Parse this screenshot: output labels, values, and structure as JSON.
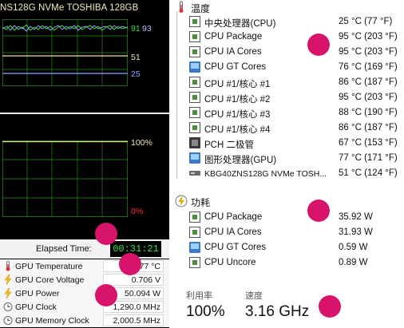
{
  "left_panel": {
    "drive_title": "NS128G NVMe TOSHIBA 128GB",
    "graph1": {
      "labels": [
        {
          "text": "91",
          "color": "#3ee14a"
        },
        {
          "text": "93",
          "color": "#b8b8ff"
        },
        {
          "text": "51",
          "color": "#f0ecb8"
        },
        {
          "text": "25",
          "color": "#8ea4ff"
        }
      ]
    },
    "graph2": {
      "top_label": "100%",
      "bottom_label": "0%"
    },
    "elapsed": {
      "label": "Elapsed Time:",
      "value": "00:31:21"
    },
    "sensors": [
      {
        "name": "GPU Temperature",
        "value": "77 °C",
        "icon": "thermometer-icon"
      },
      {
        "name": "GPU Core Voltage",
        "value": "0.706 V",
        "icon": "bolt-icon"
      },
      {
        "name": "GPU Power",
        "value": "50.094 W",
        "icon": "bolt-icon"
      },
      {
        "name": "GPU Clock",
        "value": "1,290.0 MHz",
        "icon": "clock-icon"
      },
      {
        "name": "GPU Memory Clock",
        "value": "2,000.5 MHz",
        "icon": "clock-icon"
      }
    ]
  },
  "right_panel": {
    "temperature": {
      "title": "温度",
      "icon": "thermometer-icon",
      "rows": [
        {
          "name": "中央处理器(CPU)",
          "value": "25 °C  (77 °F)",
          "icon": "cpu-chip-icon"
        },
        {
          "name": "CPU Package",
          "value": "95 °C  (203 °F)",
          "icon": "cpu-chip-icon"
        },
        {
          "name": "CPU IA Cores",
          "value": "95 °C  (203 °F)",
          "icon": "cpu-chip-icon"
        },
        {
          "name": "CPU GT Cores",
          "value": "76 °C  (169 °F)",
          "icon": "gpu-icon"
        },
        {
          "name": "CPU #1/核心 #1",
          "value": "86 °C  (187 °F)",
          "icon": "cpu-chip-icon"
        },
        {
          "name": "CPU #1/核心 #2",
          "value": "95 °C  (203 °F)",
          "icon": "cpu-chip-icon"
        },
        {
          "name": "CPU #1/核心 #3",
          "value": "88 °C  (190 °F)",
          "icon": "cpu-chip-icon"
        },
        {
          "name": "CPU #1/核心 #4",
          "value": "86 °C  (187 °F)",
          "icon": "cpu-chip-icon"
        },
        {
          "name": "PCH 二极管",
          "value": "67 °C  (153 °F)",
          "icon": "pch-chip-icon"
        },
        {
          "name": "图形处理器(GPU)",
          "value": "77 °C  (171 °F)",
          "icon": "gpu-icon"
        },
        {
          "name": "KBG40ZNS128G NVMe TOSH...",
          "value": "51 °C  (124 °F)",
          "icon": "ssd-icon"
        }
      ]
    },
    "power": {
      "title": "功耗",
      "icon": "power-icon",
      "rows": [
        {
          "name": "CPU Package",
          "value": "35.92 W",
          "icon": "cpu-chip-icon"
        },
        {
          "name": "CPU IA Cores",
          "value": "31.93 W",
          "icon": "cpu-chip-icon"
        },
        {
          "name": "CPU GT Cores",
          "value": "0.59 W",
          "icon": "gpu-icon"
        },
        {
          "name": "CPU Uncore",
          "value": "0.89 W",
          "icon": "cpu-chip-icon"
        }
      ]
    },
    "utilization": {
      "label": "利用率",
      "value": "100%"
    },
    "speed": {
      "label": "速度",
      "value": "3.16 GHz"
    }
  },
  "colors": {
    "marker": "#d8136b",
    "graph_grid": "#3a9a2a",
    "trace_green": "#3ee14a"
  }
}
